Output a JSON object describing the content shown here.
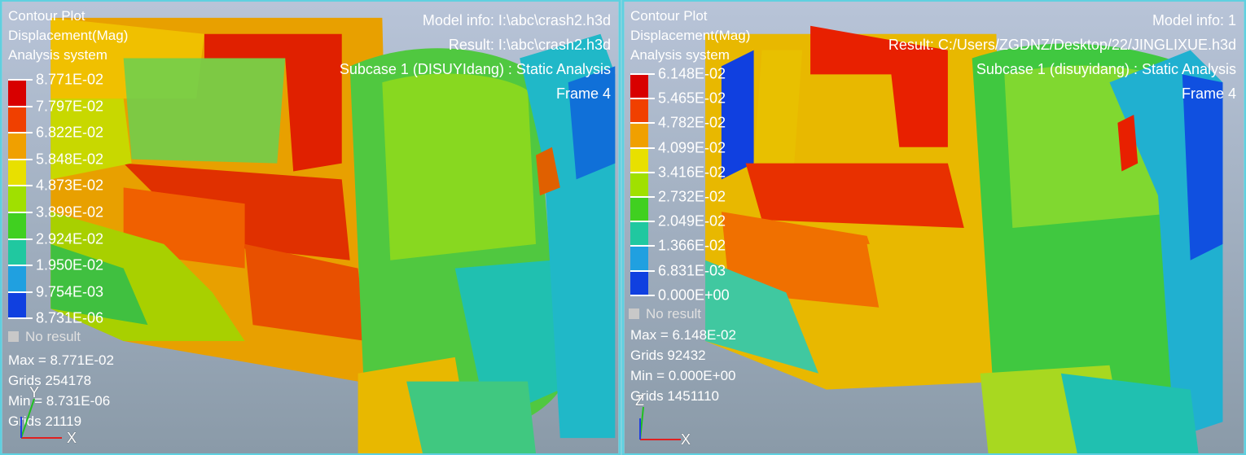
{
  "left": {
    "title": [
      "Contour Plot",
      "Displacement(Mag)",
      "Analysis system"
    ],
    "model_info": "Model info: I:\\abc\\crash2.h3d",
    "result": "Result: I:\\abc\\crash2.h3d",
    "subcase": "Subcase 1 (DISUYIdang) : Static Analysis",
    "frame": "Frame 4",
    "legend": [
      "8.771E-02",
      "7.797E-02",
      "6.822E-02",
      "5.848E-02",
      "4.873E-02",
      "3.899E-02",
      "2.924E-02",
      "1.950E-02",
      "9.754E-03",
      "8.731E-06"
    ],
    "no_result": "No result",
    "stats": [
      "Max = 8.771E-02",
      "Grids 254178",
      "Min = 8.731E-06",
      "Grids 21119"
    ],
    "axis_x": "X",
    "axis_y": "Y"
  },
  "right": {
    "title": [
      "Contour Plot",
      "Displacement(Mag)",
      "Analysis system"
    ],
    "model_info": "Model info: 1",
    "result": "Result: C:/Users/ZGDNZ/Desktop/22/JINGLIXUE.h3d",
    "subcase": "Subcase 1 (disuyidang) : Static Analysis",
    "frame": "Frame 4",
    "legend": [
      "6.148E-02",
      "5.465E-02",
      "4.782E-02",
      "4.099E-02",
      "3.416E-02",
      "2.732E-02",
      "2.049E-02",
      "1.366E-02",
      "6.831E-03",
      "0.000E+00"
    ],
    "no_result": "No result",
    "stats": [
      "Max = 6.148E-02",
      "Grids 92432",
      "Min = 0.000E+00",
      "Grids 1451110"
    ],
    "axis_x": "X",
    "axis_z": "Z"
  },
  "colors": {
    "legend_scale": [
      "#d80000",
      "#f04000",
      "#f0a000",
      "#e8e000",
      "#a0e000",
      "#40d020",
      "#20c8a0",
      "#20a0e0",
      "#1040e0",
      "#0000b0"
    ],
    "background_top": "#b8c4d8",
    "background_bottom": "#8a9aa8"
  }
}
